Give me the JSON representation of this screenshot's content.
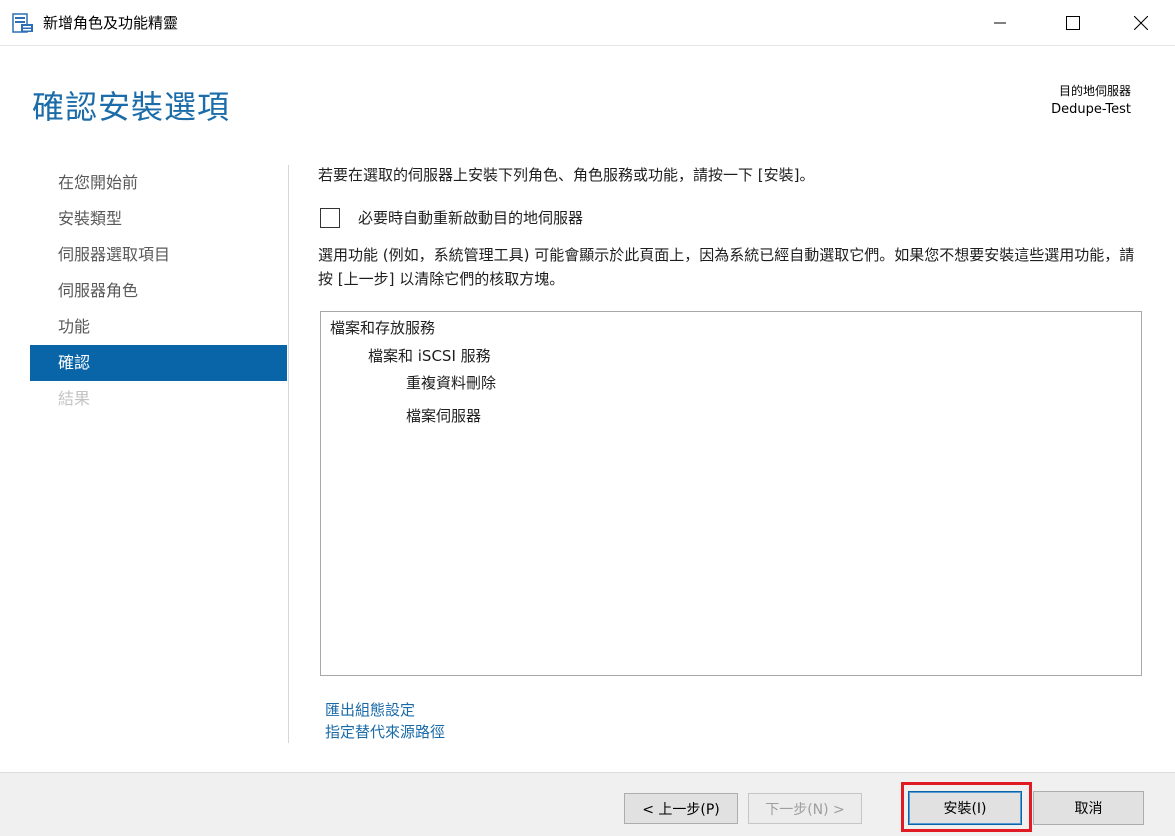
{
  "window": {
    "title": "新增角色及功能精靈",
    "icon": "server-manager-icon",
    "controls": {
      "minimize": "minimize-icon",
      "maximize": "maximize-icon",
      "close": "close-icon"
    }
  },
  "header": {
    "page_title": "確認安裝選項",
    "destination_label": "目的地伺服器",
    "destination_server": "Dedupe-Test"
  },
  "nav": {
    "items": [
      {
        "label": "在您開始前",
        "state": "normal"
      },
      {
        "label": "安裝類型",
        "state": "normal"
      },
      {
        "label": "伺服器選取項目",
        "state": "normal"
      },
      {
        "label": "伺服器角色",
        "state": "normal"
      },
      {
        "label": "功能",
        "state": "normal"
      },
      {
        "label": "確認",
        "state": "active"
      },
      {
        "label": "結果",
        "state": "disabled"
      }
    ]
  },
  "main": {
    "intro": "若要在選取的伺服器上安裝下列角色、角色服務或功能，請按一下 [安裝]。",
    "restart_checkbox": {
      "label": "必要時自動重新啟動目的地伺服器",
      "checked": false
    },
    "note": "選用功能 (例如，系統管理工具) 可能會顯示於此頁面上，因為系統已經自動選取它們。如果您不想要安裝這些選用功能，請按 [上一步] 以清除它們的核取方塊。",
    "selections": [
      {
        "text": "檔案和存放服務",
        "level": 0
      },
      {
        "text": "檔案和 iSCSI 服務",
        "level": 1
      },
      {
        "text": "重複資料刪除",
        "level": 2
      },
      {
        "text": "檔案伺服器",
        "level": 2
      }
    ],
    "links": {
      "export": "匯出組態設定",
      "alt_source": "指定替代來源路徑"
    }
  },
  "footer": {
    "prev": "< 上一步(P)",
    "next": "下一步(N) >",
    "install": "安裝(I)",
    "cancel": "取消"
  },
  "colors": {
    "accent": "#0a64a8",
    "title": "#1b6ca8",
    "link": "#1a6aa8",
    "highlight": "#e01b24"
  }
}
